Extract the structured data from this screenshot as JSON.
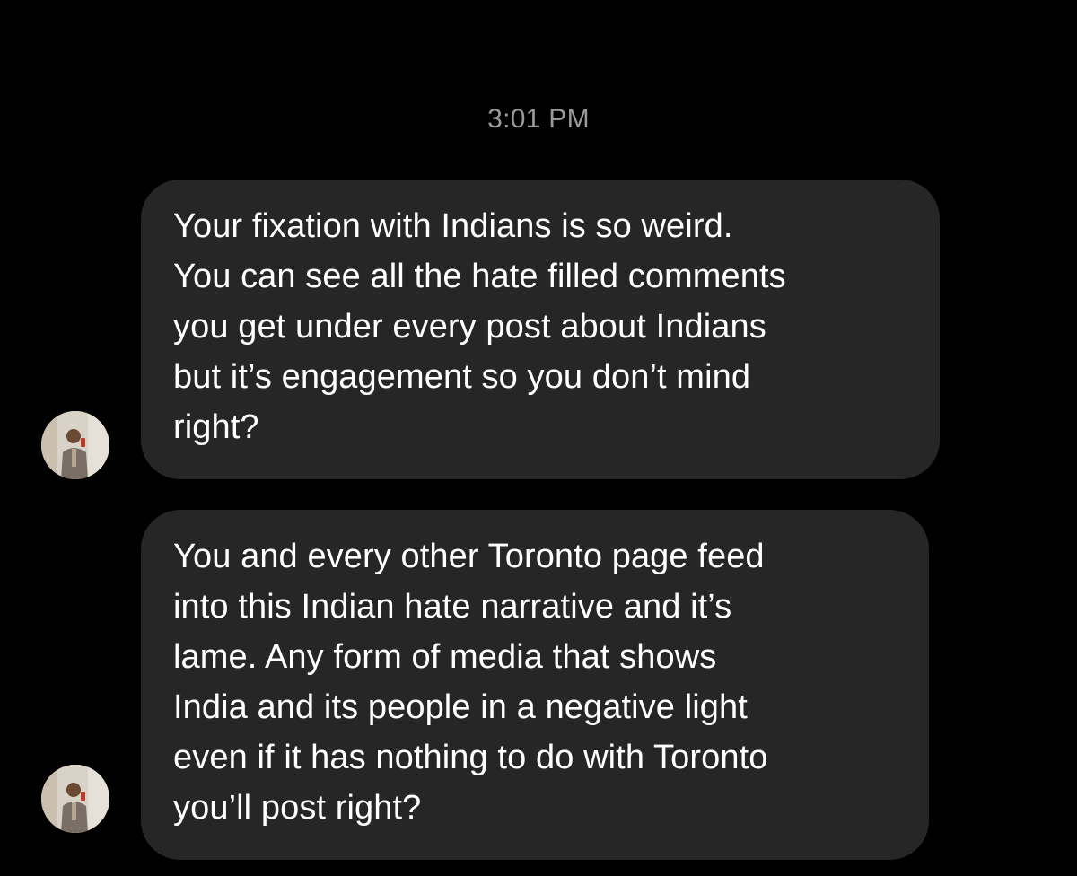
{
  "conversation": {
    "timestamp": "3:01 PM",
    "messages": [
      {
        "sender": "other",
        "text": "Your fixation with Indians is so weird.\nYou can see all the hate filled comments\nyou get under every post about Indians\nbut it’s engagement so you don’t mind\nright?"
      },
      {
        "sender": "other",
        "text": "You and every other Toronto page feed\ninto this Indian hate narrative and it’s\nlame. Any form of media that shows\nIndia and its people in a negative light\neven if it has nothing to do with Toronto\nyou’ll post right?"
      }
    ]
  },
  "colors": {
    "background": "#000000",
    "bubble": "#262626",
    "timestamp_text": "#9a9a9a",
    "message_text": "#ffffff"
  },
  "icons": {
    "avatar": "sender-avatar-photo"
  }
}
